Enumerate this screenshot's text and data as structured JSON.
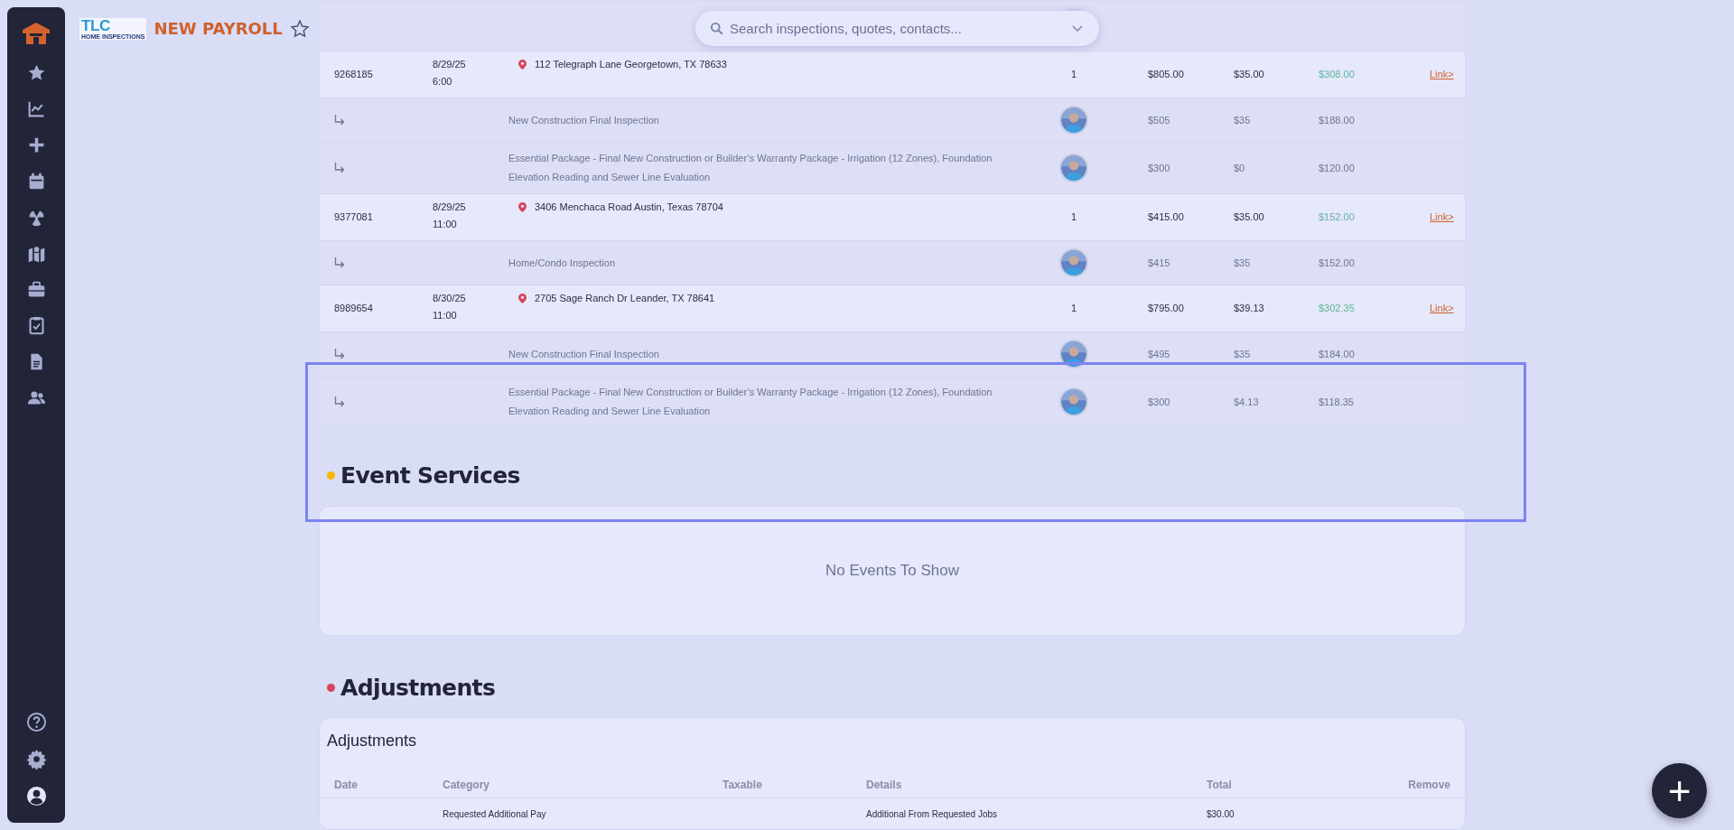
{
  "header": {
    "logo_text": "TLC",
    "logo_subtext": "HOME INSPECTIONS",
    "title": "NEW PAYROLL",
    "favorite": false
  },
  "search": {
    "placeholder": "Search inspections, quotes, contacts..."
  },
  "sidebar": {
    "items": [
      {
        "kind": "star"
      },
      {
        "kind": "chart"
      },
      {
        "kind": "plus"
      },
      {
        "kind": "calendar"
      },
      {
        "kind": "radiation"
      },
      {
        "kind": "map"
      },
      {
        "kind": "briefcase"
      },
      {
        "kind": "clipboard"
      },
      {
        "kind": "file"
      },
      {
        "kind": "users"
      }
    ],
    "bottom_items": [
      {
        "kind": "help"
      },
      {
        "kind": "settings"
      },
      {
        "kind": "account"
      }
    ]
  },
  "inspections": [
    {
      "id": "9268185",
      "date": "8/29/25",
      "time": "6:00",
      "address": "112 Telegraph Lane Georgetown, TX 78633",
      "quantity": "1",
      "price": "$805.00",
      "fee": "$35.00",
      "total": "$308.00",
      "link": "Link>",
      "services": [
        {
          "name": "New Construction Final Inspection",
          "price": "$505",
          "fee": "$35",
          "total": "$188.00"
        },
        {
          "name": "Essential Package - Final New Construction or Builder’s Warranty Package - Irrigation (12 Zones), Foundation Elevation Reading and Sewer Line Evaluation",
          "price": "$300",
          "fee": "$0",
          "total": "$120.00"
        }
      ]
    },
    {
      "id": "9377081",
      "date": "8/29/25",
      "time": "11:00",
      "address": "3406 Menchaca Road Austin, Texas 78704",
      "quantity": "1",
      "price": "$415.00",
      "fee": "$35.00",
      "total": "$152.00",
      "link": "Link>",
      "services": [
        {
          "name": "Home/Condo Inspection",
          "price": "$415",
          "fee": "$35",
          "total": "$152.00"
        }
      ]
    },
    {
      "id": "8989654",
      "date": "8/30/25",
      "time": "11:00",
      "address": "2705 Sage Ranch Dr Leander, TX 78641",
      "quantity": "1",
      "price": "$795.00",
      "fee": "$39.13",
      "total": "$302.35",
      "link": "Link>",
      "services": [
        {
          "name": "New Construction Final Inspection",
          "price": "$495",
          "fee": "$35",
          "total": "$184.00"
        },
        {
          "name": "Essential Package - Final New Construction or Builder’s Warranty Package - Irrigation (12 Zones), Foundation Elevation Reading and Sewer Line Evaluation",
          "price": "$300",
          "fee": "$4.13",
          "total": "$118.35"
        }
      ]
    }
  ],
  "event_services": {
    "title": "Event Services",
    "color": "#f5b800",
    "empty_text": "No Events To Show"
  },
  "adjustments": {
    "title": "Adjustments",
    "color": "#d6455d",
    "card_title": "Adjustments",
    "columns": [
      "Date",
      "Category",
      "Taxable",
      "Details",
      "Total",
      "Remove"
    ],
    "rows": [
      {
        "date": "",
        "category": "Requested Additional Pay",
        "details": "Additional From Requested Jobs",
        "total": "$30.00"
      }
    ]
  },
  "fab": {
    "label": "+"
  }
}
